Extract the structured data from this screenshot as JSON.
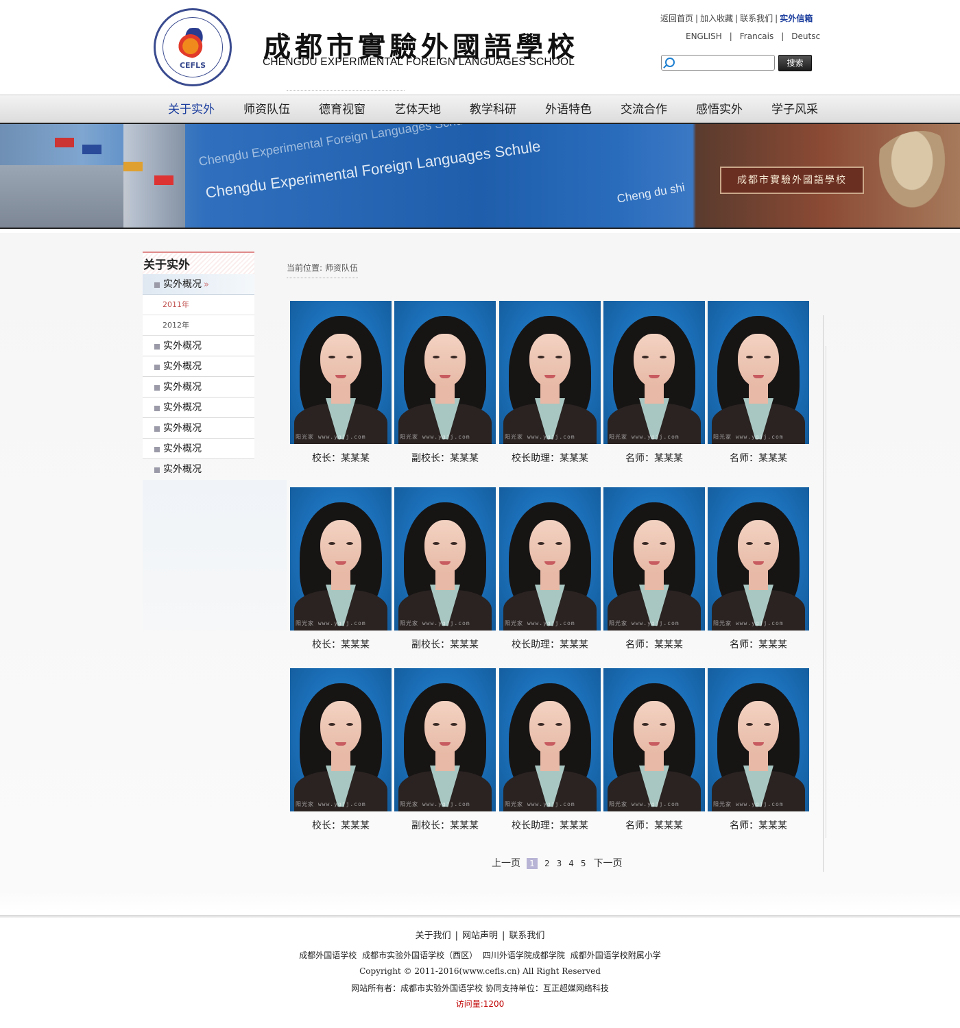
{
  "header": {
    "logo_abbr": "CEFLS",
    "logo_ring_text": "CHENGDU EXPERIMENTAL FOREIGN LANGUAGES SCHOOL",
    "school_name_cn": "成都市實驗外國語學校",
    "school_name_en": "CHENGDU EXPERIMENTAL FOREIGN LANGUAGES SCHOOL",
    "top_links": [
      "返回首页",
      "加入收藏",
      "联系我们",
      "实外信箱"
    ],
    "languages": [
      "ENGLISH",
      "Francais",
      "Deutsc"
    ],
    "search": {
      "placeholder": "",
      "button": "搜索",
      "icon": "search-icon"
    }
  },
  "nav": {
    "items": [
      "关于实外",
      "师资队伍",
      "德育视窗",
      "艺体天地",
      "教学科研",
      "外语特色",
      "交流合作",
      "感悟实外",
      "学子风采"
    ],
    "active_index": 0,
    "active_color": "#1d3f9e"
  },
  "banner": {
    "texts": [
      "Chengdu Experimental Foreign Languages Schule",
      "Chengdu Experimental Foreign Languages Schule",
      "Cheng du shi"
    ],
    "sign": "成都市實驗外國語學校"
  },
  "sidebar": {
    "title": "关于实外",
    "items": [
      {
        "label": "实外概况",
        "active": true,
        "subs": [
          "2011年",
          "2012年"
        ]
      },
      {
        "label": "实外概况"
      },
      {
        "label": "实外概况"
      },
      {
        "label": "实外概况"
      },
      {
        "label": "实外概况"
      },
      {
        "label": "实外概况"
      },
      {
        "label": "实外概况"
      },
      {
        "label": "实外概况"
      }
    ]
  },
  "breadcrumb": {
    "label": "当前位置:",
    "current": "师资队伍"
  },
  "staff": {
    "watermark": "阳光家 www.ygjj.com",
    "rows": [
      [
        "校长：某某某",
        "副校长：某某某",
        "校长助理：某某某",
        "名师：某某某",
        "名师：某某某"
      ],
      [
        "校长：某某某",
        "副校长：某某某",
        "校长助理：某某某",
        "名师：某某某",
        "名师：某某某"
      ],
      [
        "校长：某某某",
        "副校长：某某某",
        "校长助理：某某某",
        "名师：某某某",
        "名师：某某某"
      ]
    ]
  },
  "pager": {
    "prev": "上一页",
    "pages": [
      "1",
      "2",
      "3",
      "4",
      "5"
    ],
    "current": "1",
    "next": "下一页"
  },
  "footer": {
    "links": [
      "关于我们",
      "网站声明",
      "联系我们"
    ],
    "schools": [
      "成都外国语学校",
      "成都市实验外国语学校（西区）",
      "四川外语学院成都学院",
      "成都外国语学校附属小学"
    ],
    "copyright": "Copyright © 2011-2016(www.cefls.cn) All Right Reserved",
    "owner": "网站所有者：成都市实验外国语学校 协同支持单位：互正超媒网络科技",
    "visits": "访问量:1200"
  }
}
